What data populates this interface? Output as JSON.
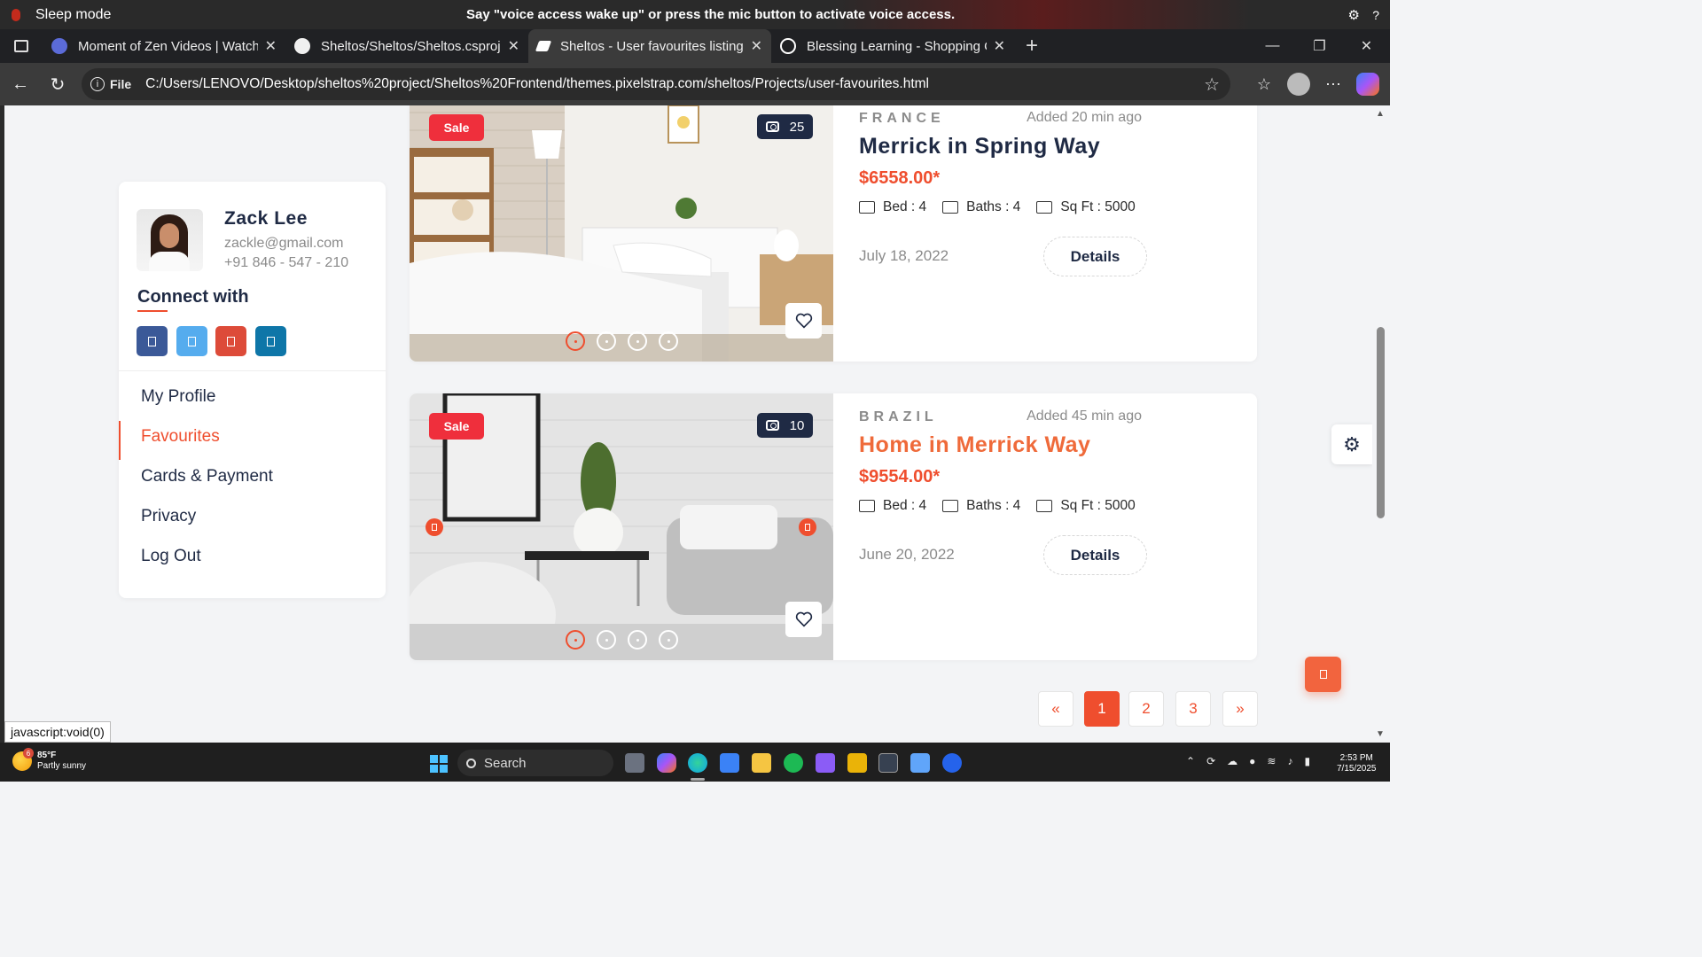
{
  "voice_access": {
    "state": "Sleep mode",
    "message": "Say \"voice access wake up\" or press the mic button to activate voice access.",
    "help": "?"
  },
  "browser": {
    "tabs": [
      {
        "title": "Moment of Zen Videos | Watch",
        "favicon_color": "#5b6bd8"
      },
      {
        "title": "Sheltos/Sheltos/Sheltos.csproj at",
        "favicon_color": "#f0f0f0"
      },
      {
        "title": "Sheltos - User favourites listing page",
        "favicon_color": "#ffffff"
      },
      {
        "title": "Blessing Learning - Shopping Cart",
        "favicon_color": "#ffffff"
      }
    ],
    "close_glyph": "✕",
    "new_tab_glyph": "+",
    "address": {
      "scheme_label": "File",
      "url": "C:/Users/LENOVO/Desktop/sheltos%20project/Sheltos%20Frontend/themes.pixelstrap.com/sheltos/Projects/user-favourites.html"
    }
  },
  "profile": {
    "name": "Zack Lee",
    "email": "zackle@gmail.com",
    "phone": "+91 846 - 547 - 210",
    "connect_heading": "Connect with",
    "social": [
      {
        "icon": "facebook-icon",
        "color": "#3b5998"
      },
      {
        "icon": "twitter-icon",
        "color": "#55acee"
      },
      {
        "icon": "google-icon",
        "color": "#dd4b39"
      },
      {
        "icon": "linkedin-icon",
        "color": "#0e76a8"
      }
    ],
    "menu": [
      "My Profile",
      "Favourites",
      "Cards & Payment",
      "Privacy",
      "Log Out"
    ],
    "active_menu": "Favourites"
  },
  "listings": [
    {
      "badge": "Sale",
      "photo_count": "25",
      "country": "FRANCE",
      "added": "Added 20 min ago",
      "title": "Merrick in Spring Way",
      "price": "$6558.00*",
      "bed": "Bed : 4",
      "baths": "Baths : 4",
      "sqft": "Sq Ft : 5000",
      "date": "July 18, 2022",
      "button": "Details"
    },
    {
      "badge": "Sale",
      "photo_count": "10",
      "country": "BRAZIL",
      "added": "Added 45 min ago",
      "title": "Home in Merrick Way",
      "price": "$9554.00*",
      "bed": "Bed : 4",
      "baths": "Baths : 4",
      "sqft": "Sq Ft : 5000",
      "date": "June 20, 2022",
      "button": "Details"
    }
  ],
  "pagination": {
    "prev": "«",
    "pages": [
      "1",
      "2",
      "3"
    ],
    "current": "1",
    "next": "»"
  },
  "status_tip": "javascript:void(0)",
  "taskbar": {
    "weather_temp": "85°F",
    "weather_desc": "Partly sunny",
    "weather_badge": "6",
    "search_label": "Search",
    "time": "2:53 PM",
    "date": "7/15/2025"
  },
  "colors": {
    "accent": "#ef4e2e",
    "navy": "#1f2a44",
    "sale": "#ef2f3c"
  }
}
